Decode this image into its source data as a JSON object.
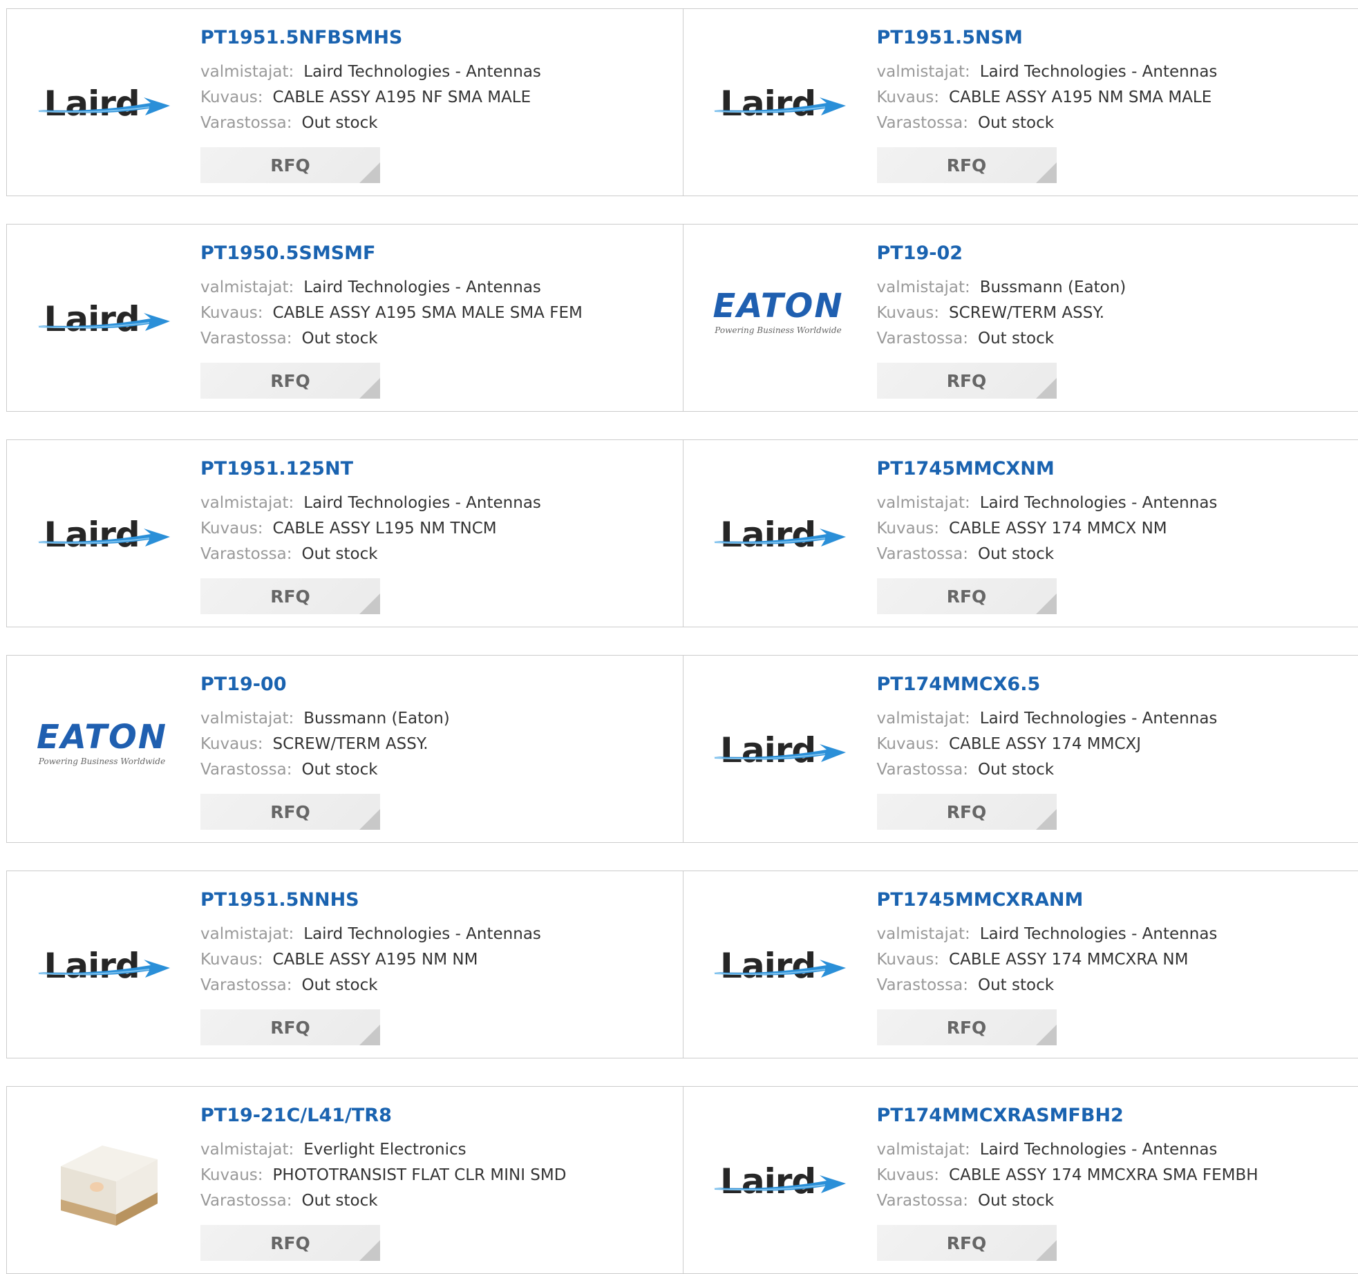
{
  "labels": {
    "manufacturer": "valmistajat:",
    "description": "Kuvaus:",
    "stock": "Varastossa:",
    "rfq": "RFQ"
  },
  "logos": {
    "laird": {
      "text": "Laird"
    },
    "eaton": {
      "text": "EATON",
      "tagline": "Powering Business Worldwide"
    }
  },
  "colors": {
    "part_link": "#1a63b0",
    "label": "#999999",
    "value": "#333333",
    "border": "#cccccc"
  },
  "products": [
    {
      "part": "PT1951.5NFBSMHS",
      "logo": "laird-logo",
      "manufacturer": "Laird Technologies - Antennas",
      "description": "CABLE ASSY A195 NF SMA MALE",
      "stock": "Out stock"
    },
    {
      "part": "PT1951.5NSM",
      "logo": "laird-logo",
      "manufacturer": "Laird Technologies - Antennas",
      "description": "CABLE ASSY A195 NM SMA MALE",
      "stock": "Out stock"
    },
    {
      "part": "PT1950.5SMSMF",
      "logo": "laird-logo",
      "manufacturer": "Laird Technologies - Antennas",
      "description": "CABLE ASSY A195 SMA MALE SMA FEM",
      "stock": "Out stock"
    },
    {
      "part": "PT19-02",
      "logo": "eaton-logo",
      "manufacturer": "Bussmann (Eaton)",
      "description": "SCREW/TERM ASSY.",
      "stock": "Out stock"
    },
    {
      "part": "PT1951.125NT",
      "logo": "laird-logo",
      "manufacturer": "Laird Technologies - Antennas",
      "description": "CABLE ASSY L195 NM TNCM",
      "stock": "Out stock"
    },
    {
      "part": "PT1745MMCXNM",
      "logo": "laird-logo",
      "manufacturer": "Laird Technologies - Antennas",
      "description": "CABLE ASSY 174 MMCX NM",
      "stock": "Out stock"
    },
    {
      "part": "PT19-00",
      "logo": "eaton-logo",
      "manufacturer": "Bussmann (Eaton)",
      "description": "SCREW/TERM ASSY.",
      "stock": "Out stock"
    },
    {
      "part": "PT174MMCX6.5",
      "logo": "laird-logo",
      "manufacturer": "Laird Technologies - Antennas",
      "description": "CABLE ASSY 174 MMCXJ",
      "stock": "Out stock"
    },
    {
      "part": "PT1951.5NNHS",
      "logo": "laird-logo",
      "manufacturer": "Laird Technologies - Antennas",
      "description": "CABLE ASSY A195 NM NM",
      "stock": "Out stock"
    },
    {
      "part": "PT1745MMCXRANM",
      "logo": "laird-logo",
      "manufacturer": "Laird Technologies - Antennas",
      "description": "CABLE ASSY 174 MMCXRA NM",
      "stock": "Out stock"
    },
    {
      "part": "PT19-21C/L41/TR8",
      "logo": "smd-component-image",
      "manufacturer": "Everlight Electronics",
      "description": "PHOTOTRANSIST FLAT CLR MINI SMD",
      "stock": "Out stock"
    },
    {
      "part": "PT174MMCXRASMFBH2",
      "logo": "laird-logo",
      "manufacturer": "Laird Technologies - Antennas",
      "description": "CABLE ASSY 174 MMCXRA SMA FEMBH",
      "stock": "Out stock"
    }
  ]
}
